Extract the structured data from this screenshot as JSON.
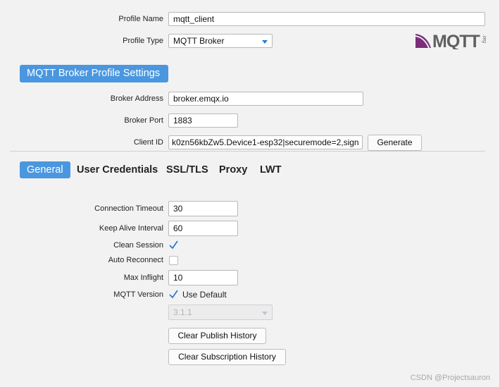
{
  "profile": {
    "name_label": "Profile Name",
    "name_value": "mqtt_client",
    "type_label": "Profile Type",
    "type_value": "MQTT Broker",
    "logo_text": "MQTT",
    "logo_small": ".org"
  },
  "broker": {
    "section_title": "MQTT Broker Profile Settings",
    "address_label": "Broker Address",
    "address_value": "broker.emqx.io",
    "port_label": "Broker Port",
    "port_value": "1883",
    "client_id_label": "Client ID",
    "client_id_value": "k0zn56kbZw5.Device1-esp32|securemode=2,sign",
    "generate_label": "Generate"
  },
  "tabs": [
    {
      "label": "General",
      "active": true
    },
    {
      "label": "User Credentials",
      "active": false
    },
    {
      "label": "SSL/TLS",
      "active": false
    },
    {
      "label": "Proxy",
      "active": false
    },
    {
      "label": "LWT",
      "active": false
    }
  ],
  "general": {
    "connection_timeout_label": "Connection Timeout",
    "connection_timeout_value": "30",
    "keep_alive_label": "Keep Alive Interval",
    "keep_alive_value": "60",
    "clean_session_label": "Clean Session",
    "clean_session_checked": true,
    "auto_reconnect_label": "Auto Reconnect",
    "auto_reconnect_checked": false,
    "max_inflight_label": "Max Inflight",
    "max_inflight_value": "10",
    "mqtt_version_label": "MQTT Version",
    "use_default_label": "Use Default",
    "use_default_checked": true,
    "version_value": "3.1.1",
    "clear_publish_label": "Clear Publish History",
    "clear_subscription_label": "Clear Subscription History"
  },
  "watermark": "CSDN @Projectsauron",
  "colors": {
    "accent": "#4a97e0",
    "check": "#2a7ad1",
    "logo": "#7a2d7a"
  }
}
